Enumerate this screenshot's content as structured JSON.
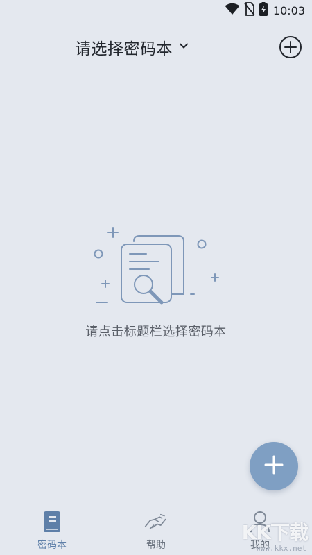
{
  "status_bar": {
    "time": "10:03",
    "icons": [
      "wifi-icon",
      "no-sim-icon",
      "battery-charging-icon"
    ]
  },
  "header": {
    "title": "请选择密码本",
    "title_icon": "chevron-down-icon",
    "action_icon": "add-circle-icon"
  },
  "empty_state": {
    "illustration": "document-search-illustration",
    "message": "请点击标题栏选择密码本"
  },
  "fab": {
    "icon": "plus-icon",
    "color": "#7f9fc3"
  },
  "bottom_nav": {
    "items": [
      {
        "label": "密码本",
        "icon": "notebook-icon",
        "active": true
      },
      {
        "label": "帮助",
        "icon": "handshake-icon",
        "active": false
      },
      {
        "label": "我的",
        "icon": "user-icon",
        "active": false
      }
    ]
  },
  "watermark": {
    "logo": "KK下载",
    "url": "www.kkx.net"
  },
  "colors": {
    "background": "#e4e8ef",
    "accent": "#5e7fa8",
    "illustration_stroke": "#7e97b8"
  }
}
